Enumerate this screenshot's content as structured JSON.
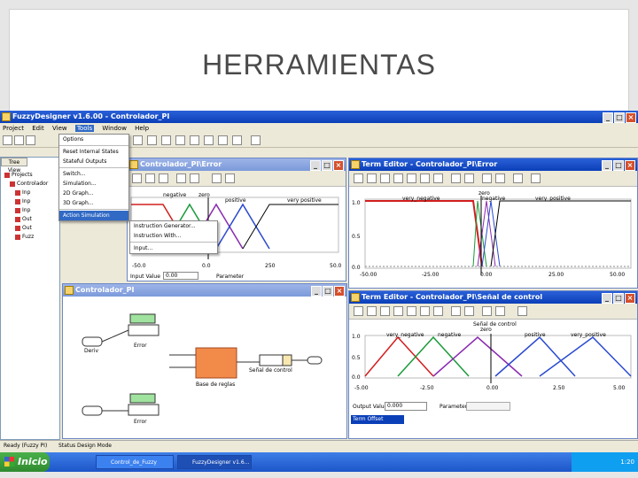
{
  "slide": {
    "title": "HERRAMIENTAS"
  },
  "app": {
    "title": "FuzzyDesigner v1.6.00 - Controlador_PI",
    "menus": [
      "Project",
      "Edit",
      "View",
      "Tools",
      "Window",
      "Help"
    ],
    "active_menu": "Tools"
  },
  "tools_menu": {
    "items": [
      "Options",
      "Reset Internal States",
      "Stateful Outputs",
      "Switch...",
      "Simulation...",
      "2D Graph...",
      "3D Graph...",
      "Action Simulation"
    ],
    "highlighted": "Action Simulation"
  },
  "submenu": {
    "items": [
      "Instruction Generator...",
      "Instruction With...",
      "Input..."
    ]
  },
  "tree": {
    "tab": "Tree View",
    "items": [
      "Projects",
      "Controlador",
      "Inp",
      "Inp",
      "Inp",
      "Out",
      "Out",
      "Fuzz"
    ]
  },
  "editor1": {
    "title": "Controlador_PI\\Error",
    "terms": [
      "negative",
      "zero",
      "positive",
      "very positive"
    ],
    "ticks": [
      "-50.0",
      "0.0",
      "250",
      "50.0"
    ],
    "input_label": "Input Value",
    "input_value": "0.00",
    "param_label": "Parameter"
  },
  "editor2": {
    "title": "Term Editor - Controlador_PI\\Error",
    "terms": [
      "very_negative",
      "negative",
      "zero",
      "positive",
      "very_positive"
    ],
    "yticks": [
      "1.0",
      "0.5",
      "0.0"
    ],
    "xticks": [
      "-50.00",
      "-25.00",
      "0.00",
      "25.00",
      "50.00"
    ]
  },
  "diagram": {
    "title": "Controlador_PI",
    "blocks": [
      "Error",
      "Deriv",
      "Error",
      "Base de reglas",
      "Señal de control"
    ]
  },
  "editor3": {
    "title": "Term Editor - Controlador_PI\\Señal de control",
    "header": "Señal de control",
    "terms": [
      "very_negative",
      "negative",
      "zero",
      "positive",
      "very_positive"
    ],
    "yticks": [
      "1.0",
      "0.5",
      "0.0"
    ],
    "xticks": [
      "-5.00",
      "-2.50",
      "0.00",
      "2.50",
      "5.00"
    ],
    "output_label": "Output Value",
    "output_value": "0.000",
    "param_label": "Parameter",
    "term_tab": "Term Offset"
  },
  "statusbar": {
    "left": "Ready (Fuzzy PI)",
    "right": "Status Design Mode"
  },
  "taskbar": {
    "start": "Inicio",
    "items": [
      "Control_de_Fuzzy",
      "FuzzyDesigner v1.6..."
    ],
    "time": "1:20"
  },
  "colors": {
    "red": "#d21e1e",
    "green": "#1a9a3a",
    "purple": "#8a2ab0",
    "blue": "#2a4ad0",
    "black": "#000000"
  }
}
